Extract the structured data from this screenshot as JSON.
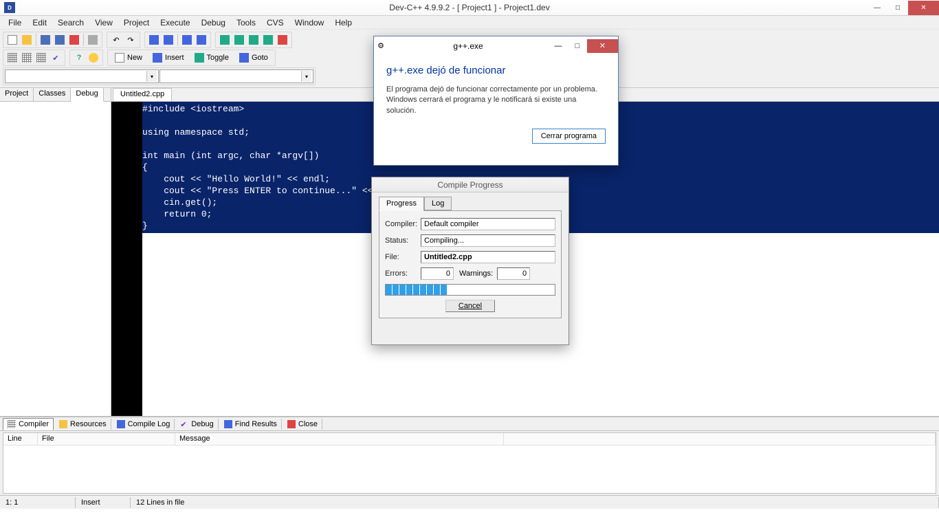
{
  "titlebar": {
    "title": "Dev-C++ 4.9.9.2  -  [ Project1 ] - Project1.dev"
  },
  "menu": {
    "items": [
      "File",
      "Edit",
      "Search",
      "View",
      "Project",
      "Execute",
      "Debug",
      "Tools",
      "CVS",
      "Window",
      "Help"
    ]
  },
  "toolbar_buttons": {
    "new": "New",
    "insert": "Insert",
    "toggle": "Toggle",
    "goto": "Goto"
  },
  "sidebar": {
    "tabs": [
      "Project",
      "Classes",
      "Debug"
    ]
  },
  "editor": {
    "tab": "Untitled2.cpp",
    "code": "#include <iostream>\n\nusing namespace std;\n\nint main (int argc, char *argv[])\n{\n    cout << \"Hello World!\" << endl;\n    cout << \"Press ENTER to continue...\" << \n    cin.get();\n    return 0;\n}"
  },
  "bottom": {
    "tabs": [
      "Compiler",
      "Resources",
      "Compile Log",
      "Debug",
      "Find Results",
      "Close"
    ],
    "columns": [
      "Line",
      "File",
      "Message"
    ]
  },
  "statusbar": {
    "pos": "1: 1",
    "mode": "Insert",
    "lines": "12 Lines in file"
  },
  "error_dialog": {
    "title": "g++.exe",
    "heading": "g++.exe dejó de funcionar",
    "body": "El programa dejó de funcionar correctamente por un problema. Windows cerrará el programa y le notificará si existe una solución.",
    "button": "Cerrar programa"
  },
  "progress_dialog": {
    "title": "Compile Progress",
    "tab_progress": "Progress",
    "tab_log": "Log",
    "lbl_compiler": "Compiler:",
    "val_compiler": "Default compiler",
    "lbl_status": "Status:",
    "val_status": "Compiling...",
    "lbl_file": "File:",
    "val_file": "Untitled2.cpp",
    "lbl_errors": "Errors:",
    "val_errors": "0",
    "lbl_warnings": "Warnings:",
    "val_warnings": "0",
    "cancel": "Cancel"
  }
}
